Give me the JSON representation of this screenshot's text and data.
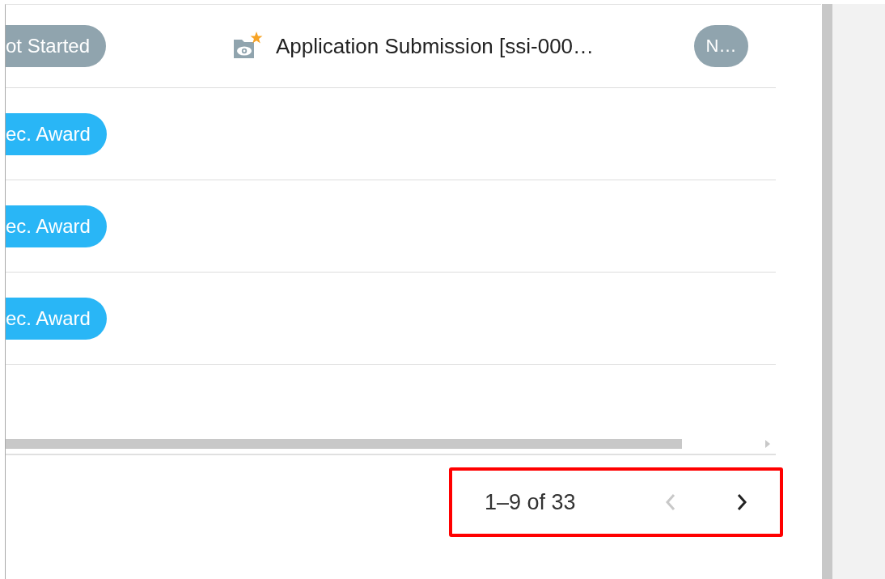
{
  "table": {
    "rows": [
      {
        "status": {
          "label": "ot Started",
          "color": "#90a4ae"
        },
        "document": {
          "title": "Application Submission [ssi-000…"
        },
        "badge": "N…"
      },
      {
        "status": {
          "label": "ec. Award",
          "color": "#29b6f6"
        }
      },
      {
        "status": {
          "label": "ec. Award",
          "color": "#29b6f6"
        }
      },
      {
        "status": {
          "label": "ec. Award",
          "color": "#29b6f6"
        }
      }
    ]
  },
  "pagination": {
    "range": "1–9 of 33",
    "previous": {
      "disabled": true
    },
    "next": {
      "disabled": false
    },
    "highlighted": true
  }
}
